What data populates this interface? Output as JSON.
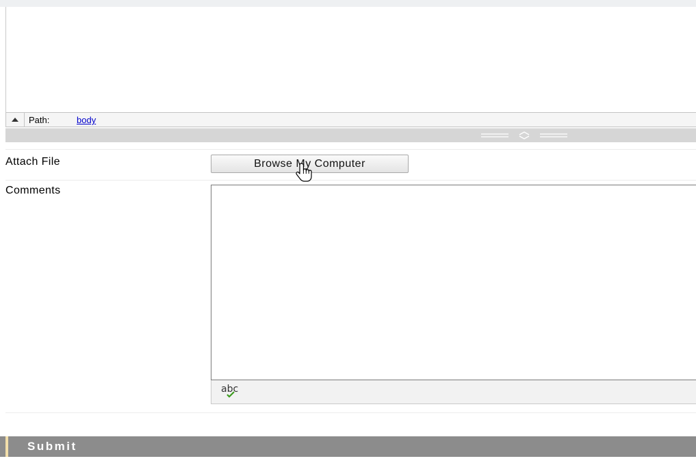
{
  "editor": {
    "path_label": "Path:",
    "path_value": "body",
    "collapse_icon": "triangle-up-icon",
    "resize_icon": "resize-handle-icon"
  },
  "attach": {
    "label": "Attach File",
    "button_label": "Browse My Computer"
  },
  "comments": {
    "label": "Comments",
    "value": "",
    "spellcheck_label": "abc",
    "spellcheck_icon": "spellcheck-icon"
  },
  "submit": {
    "label": "Submit"
  },
  "cursor": {
    "icon": "hand-pointer-icon"
  },
  "colors": {
    "link": "#0000cc",
    "submit_bar": "#8c8c8c",
    "submit_accent": "#f2deaa",
    "resize_bar": "#d6d6d6",
    "spellcheck_tick": "#3c9a1e"
  }
}
